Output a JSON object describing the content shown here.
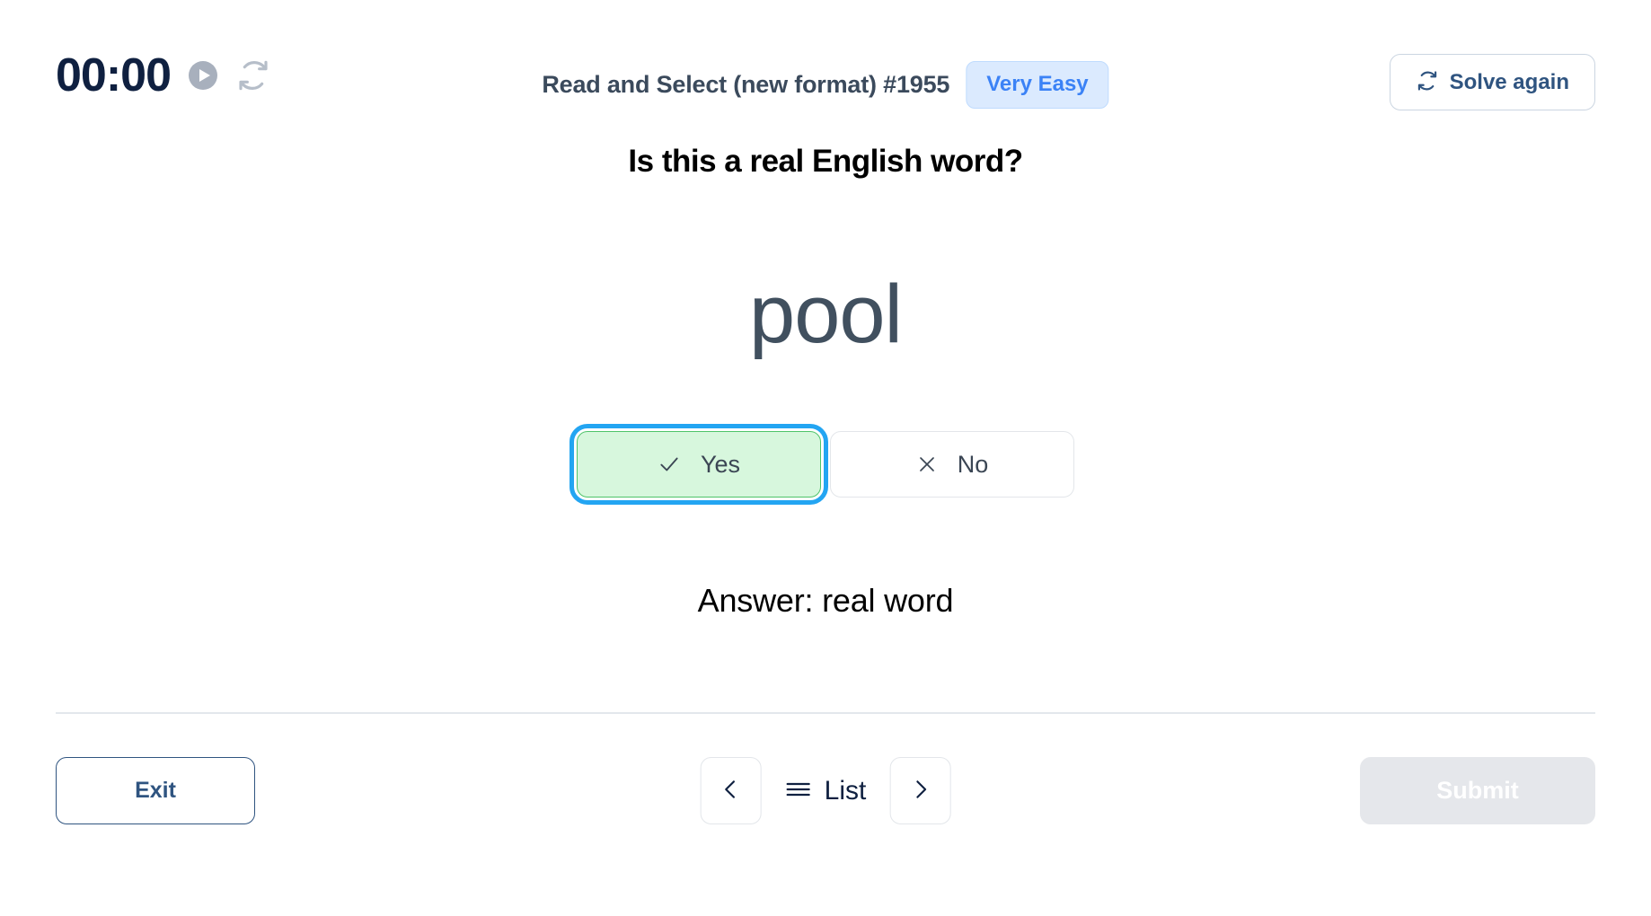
{
  "header": {
    "timer": "00:00",
    "play_icon": "play-circle-icon",
    "reset_icon": "refresh-icon",
    "exercise_title": "Read and Select (new format) #1955",
    "difficulty_badge": "Very Easy",
    "solve_again_label": "Solve again",
    "solve_again_icon": "refresh-icon"
  },
  "main": {
    "question": "Is this a real English word?",
    "prompt_word": "pool",
    "choices": [
      {
        "label": "Yes",
        "icon": "check-icon",
        "selected": true
      },
      {
        "label": "No",
        "icon": "close-icon",
        "selected": false
      }
    ],
    "answer_text": "Answer: real word"
  },
  "footer": {
    "exit_label": "Exit",
    "prev_icon": "chevron-left-icon",
    "list_label": "List",
    "list_icon": "hamburger-icon",
    "next_icon": "chevron-right-icon",
    "submit_label": "Submit"
  },
  "colors": {
    "badge_bg": "#dbeafe",
    "badge_text": "#3b82f6",
    "navy": "#0f2040",
    "slate": "#41505f",
    "selected_bg": "#d7f7dd",
    "selected_border": "#4fc46a",
    "focus_ring": "#23a5f2",
    "submit_disabled_bg": "#e5e7eb"
  }
}
